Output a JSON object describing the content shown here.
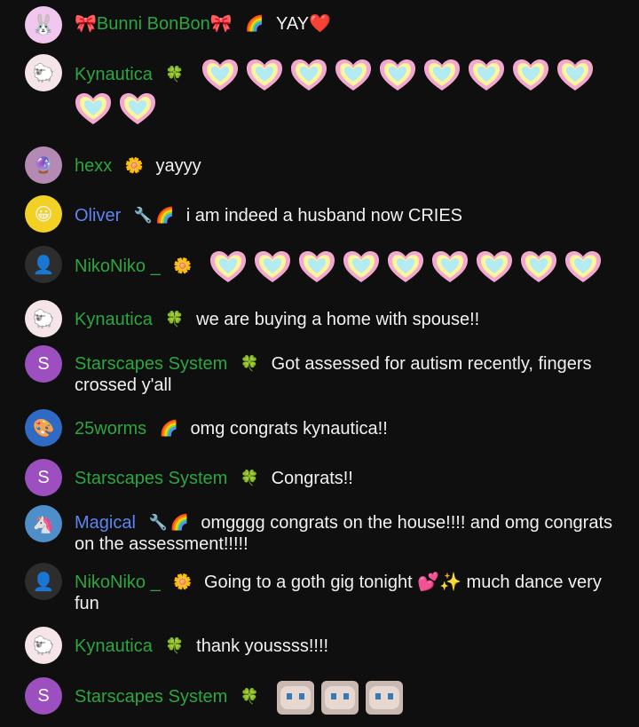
{
  "messages": [
    {
      "id": "m1",
      "author": "🎀Bunni BonBon🎀",
      "author_color": "green",
      "badges": [
        "rainbow-icon"
      ],
      "text": "YAY❤️",
      "avatar_color": "#f1c7ef",
      "avatar_letter": ""
    },
    {
      "id": "m2",
      "author": "Kynautica",
      "author_color": "green",
      "badges": [
        "clover-icon"
      ],
      "text": "",
      "emoji": "heart",
      "emoji_count": 11,
      "avatar_color": "#f5e4e8"
    },
    {
      "id": "m3",
      "author": "hexx",
      "author_color": "green",
      "badges": [
        "flower-icon"
      ],
      "text": "yayyy",
      "avatar_color": "#b48ab5"
    },
    {
      "id": "m4",
      "author": "Oliver",
      "author_color": "blue",
      "badges": [
        "wrench-icon",
        "rainbow-icon"
      ],
      "text": "i am indeed a husband now CRIES",
      "avatar_color": "#f2d024"
    },
    {
      "id": "m5",
      "author": "NikoNiko _",
      "author_color": "green",
      "badges": [
        "flower-icon"
      ],
      "text": "",
      "emoji": "heart",
      "emoji_count": 9,
      "avatar_color": "#2d2d2d"
    },
    {
      "id": "m6",
      "author": "Kynautica",
      "author_color": "green",
      "badges": [
        "clover-icon"
      ],
      "text": "we are buying a home with spouse!!",
      "avatar_color": "#f5e4e8"
    },
    {
      "id": "m7",
      "author": "Starscapes System",
      "author_color": "green",
      "badges": [
        "clover-icon"
      ],
      "text": "Got assessed for autism recently, fingers crossed y'all",
      "avatar_color": "#9c4fbf",
      "avatar_letter": "S"
    },
    {
      "id": "m8",
      "author": "25worms",
      "author_color": "green",
      "badges": [
        "rainbow-icon"
      ],
      "text": "omg congrats kynautica!!",
      "avatar_color": "#2f6ac5"
    },
    {
      "id": "m9",
      "author": "Starscapes System",
      "author_color": "green",
      "badges": [
        "clover-icon"
      ],
      "text": "Congrats!!",
      "avatar_color": "#9c4fbf",
      "avatar_letter": "S"
    },
    {
      "id": "m10",
      "author": "Magical",
      "author_color": "blue",
      "badges": [
        "wrench-icon",
        "rainbow-icon"
      ],
      "text": "omgggg congrats on the house!!!! and omg congrats on the assessment!!!!!",
      "avatar_color": "#4e8ec9"
    },
    {
      "id": "m11",
      "author": "NikoNiko _",
      "author_color": "green",
      "badges": [
        "flower-icon"
      ],
      "text": "Going to a goth gig tonight 💕✨ much dance very fun",
      "avatar_color": "#2d2d2d"
    },
    {
      "id": "m12",
      "author": "Kynautica",
      "author_color": "green",
      "badges": [
        "clover-icon"
      ],
      "text": "thank youssss!!!!",
      "avatar_color": "#f5e4e8"
    },
    {
      "id": "m13",
      "author": "Starscapes System",
      "author_color": "green",
      "badges": [
        "clover-icon"
      ],
      "text": "",
      "emoji": "cat",
      "emoji_count": 3,
      "avatar_color": "#9c4fbf",
      "avatar_letter": "S"
    }
  ],
  "colors": {
    "background": "#0f0f0f",
    "author_green": "#2ba640",
    "author_blue": "#5e84f1"
  },
  "badge_glyphs": {
    "rainbow-icon": "🌈",
    "clover-icon": "🍀",
    "flower-icon": "🌼",
    "wrench-icon": "🔧"
  }
}
